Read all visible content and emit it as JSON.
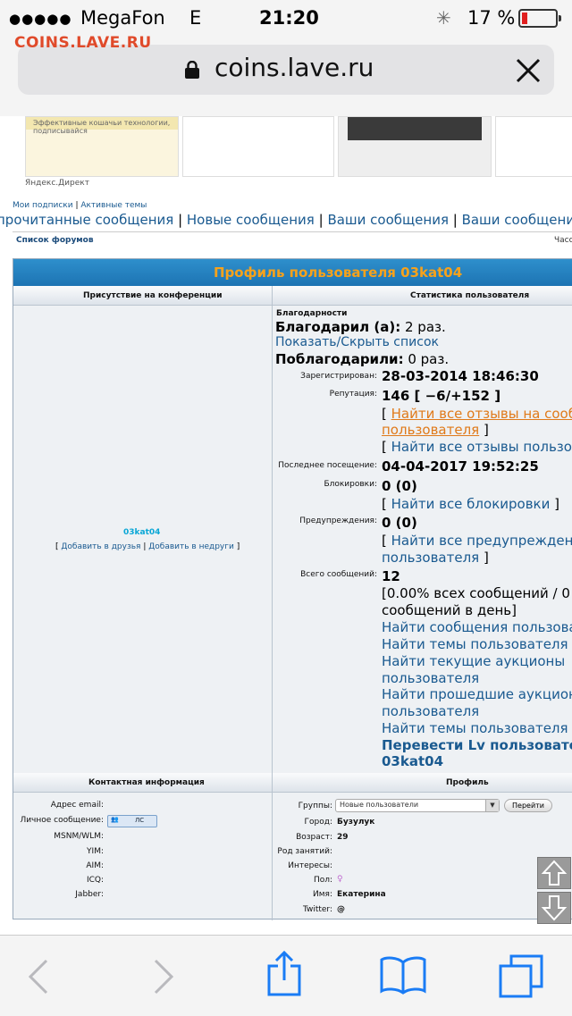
{
  "status_bar": {
    "signal_dots": "●●●●●",
    "carrier": "MegaFon",
    "network": "E",
    "time": "21:20",
    "battery_percent": "17 %",
    "battery_color": "#e02020"
  },
  "overlay_logo": "COINS.LAVE.RU",
  "browser": {
    "url": "coins.lave.ru",
    "lock_icon": "lock-icon",
    "close_icon": "close-icon"
  },
  "ads": {
    "ad1_caption": "Эффективные кошачьи технологии, подписывайся",
    "source": "Яндекс.Директ"
  },
  "top_links": {
    "subscriptions": "Мои подписки",
    "active_topics": "Активные темы",
    "unread": "прочитанные сообщения",
    "new_messages": "Новые сообщения",
    "your_messages": "Ваши сообщения",
    "your_messages_2": "Ваши сообщения"
  },
  "breadcrumb": {
    "forum_list": "Список форумов",
    "right_text": "Часо"
  },
  "profile": {
    "title": "Профиль пользователя 03kat04",
    "col_presence": "Присутствие на конференции",
    "col_stats": "Статистика пользователя",
    "username": "03kat04",
    "add_friend": "Добавить в друзья",
    "add_foe": "Добавить в недруги",
    "thanks_header": "Благодарности",
    "thanked_label": "Благодарил (а):",
    "thanked_value": "2 раз.",
    "show_hide_list": "Показать/Скрыть список",
    "was_thanked_label": "Поблагодарили:",
    "was_thanked_value": "0 раз.",
    "registered_label": "Зарегистрирован:",
    "registered_value": "28-03-2014 18:46:30",
    "reputation_label": "Репутация:",
    "reputation_value": "146 [ −6/+152 ]",
    "find_reviews_about_1": "Найти все отзывы на сооб",
    "find_reviews_about_2": "пользователя",
    "find_reviews_by": "Найти все отзывы пользов",
    "last_visit_label": "Последнее посещение:",
    "last_visit_value": "04-04-2017 19:52:25",
    "blocks_label": "Блокировки:",
    "blocks_value": "0 (0)",
    "find_blocks": "Найти все блокировки",
    "warnings_label": "Предупреждения:",
    "warnings_value": "0 (0)",
    "find_warnings_1": "Найти все предупреждени",
    "find_warnings_2": "пользователя",
    "total_posts_label": "Всего сообщений:",
    "total_posts_value": "12",
    "posts_percent_1": "[0.00% всех сообщений / 0",
    "posts_percent_2": "сообщений в день]",
    "find_user_posts": "Найти сообщения пользова",
    "find_user_topics": "Найти темы пользователя",
    "find_current_auctions_1": "Найти текущие аукционы",
    "find_current_auctions_2": "пользователя",
    "find_past_auctions_1": "Найти прошедшие аукционы",
    "find_past_auctions_2": "пользователя",
    "find_topics_in": "Найти темы пользователя в",
    "translate_lv_1": "Перевести Lv пользовате",
    "translate_lv_2": "03kat04"
  },
  "contacts": {
    "header": "Контактная информация",
    "email_label": "Адрес email:",
    "pm_label": "Личное сообщение:",
    "pm_badge": "ЛС",
    "msnm_label": "MSNM/WLM:",
    "yim_label": "YIM:",
    "aim_label": "AIM:",
    "icq_label": "ICQ:",
    "jabber_label": "Jabber:"
  },
  "profile_info": {
    "header": "Профиль",
    "groups_label": "Группы:",
    "groups_selected": "Новые пользователи",
    "go_button": "Перейти",
    "city_label": "Город:",
    "city_value": "Бузулук",
    "age_label": "Возраст:",
    "age_value": "29",
    "occupation_label": "Род занятий:",
    "interests_label": "Интересы:",
    "gender_label": "Пол:",
    "name_label": "Имя:",
    "name_value": "Екатерина",
    "twitter_label": "Twitter:",
    "twitter_value": "@"
  },
  "toolbar": {
    "back_icon": "back-chevron-icon",
    "forward_icon": "forward-chevron-icon",
    "share_icon": "share-icon",
    "bookmarks_icon": "bookmarks-icon",
    "tabs_icon": "tabs-icon"
  },
  "colors": {
    "link": "#1a5a90",
    "title_bar": "#1d74b3",
    "title_text": "#f7a21b",
    "username": "#0aa7d6",
    "orange_link": "#e07a1a",
    "ios_blue": "#1a7cf5"
  }
}
